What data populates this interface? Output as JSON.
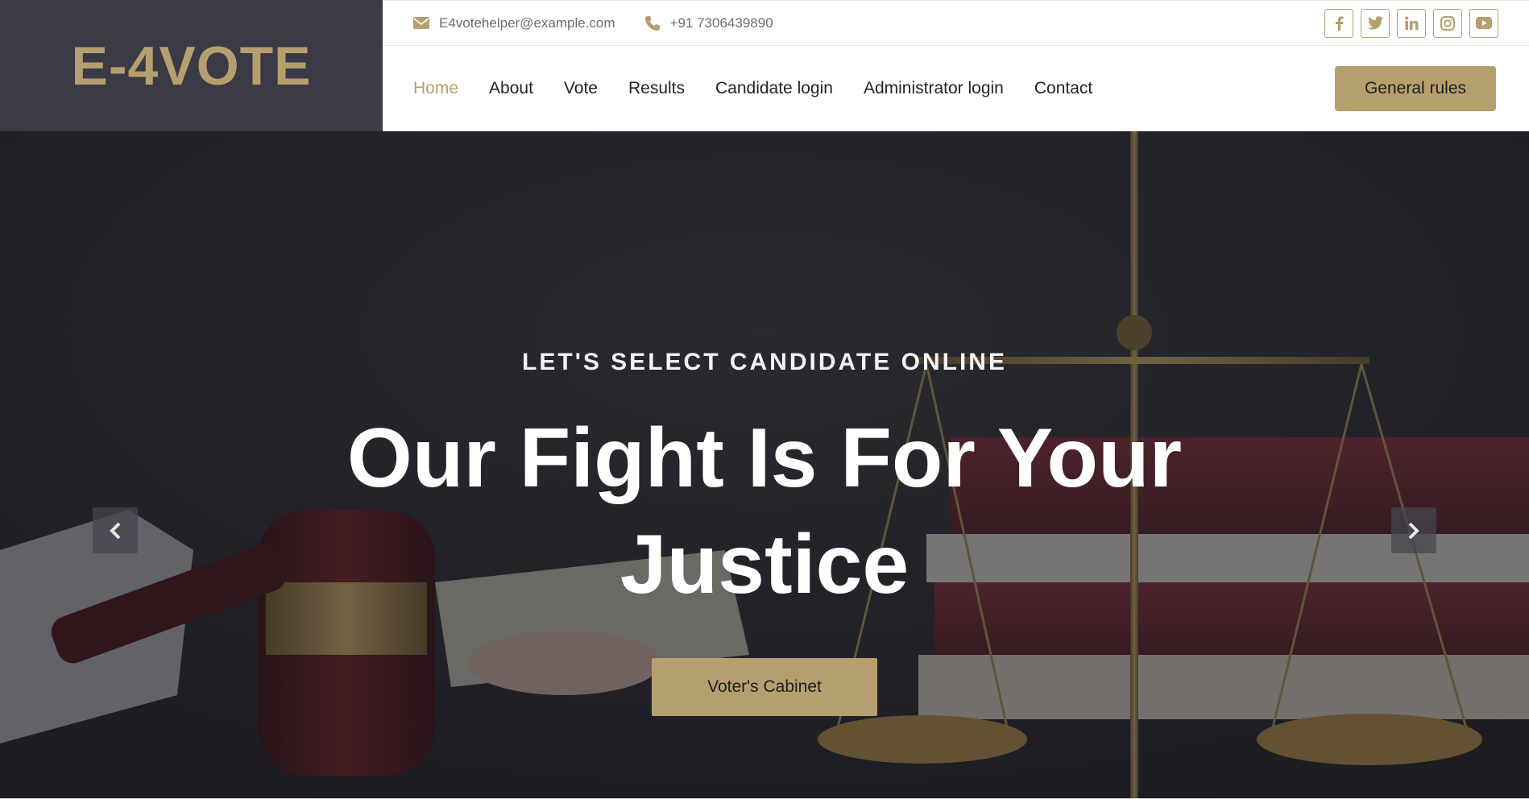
{
  "brand": {
    "title": "E-4VOTE"
  },
  "topbar": {
    "email": "E4votehelper@example.com",
    "phone": "+91 7306439890",
    "socials": [
      "facebook-icon",
      "twitter-icon",
      "linkedin-icon",
      "instagram-icon",
      "youtube-icon"
    ]
  },
  "nav": {
    "items": [
      {
        "label": "Home",
        "active": true
      },
      {
        "label": "About"
      },
      {
        "label": "Vote"
      },
      {
        "label": "Results"
      },
      {
        "label": "Candidate login"
      },
      {
        "label": "Administrator login"
      },
      {
        "label": "Contact"
      }
    ],
    "cta_label": "General rules"
  },
  "hero": {
    "kicker": "LET'S SELECT CANDIDATE ONLINE",
    "title": "Our Fight Is For Your Justice",
    "button_label": "Voter's Cabinet"
  },
  "colors": {
    "accent": "#b59f6e",
    "brand_bg": "#3b3b45",
    "text_dark": "#222326"
  }
}
